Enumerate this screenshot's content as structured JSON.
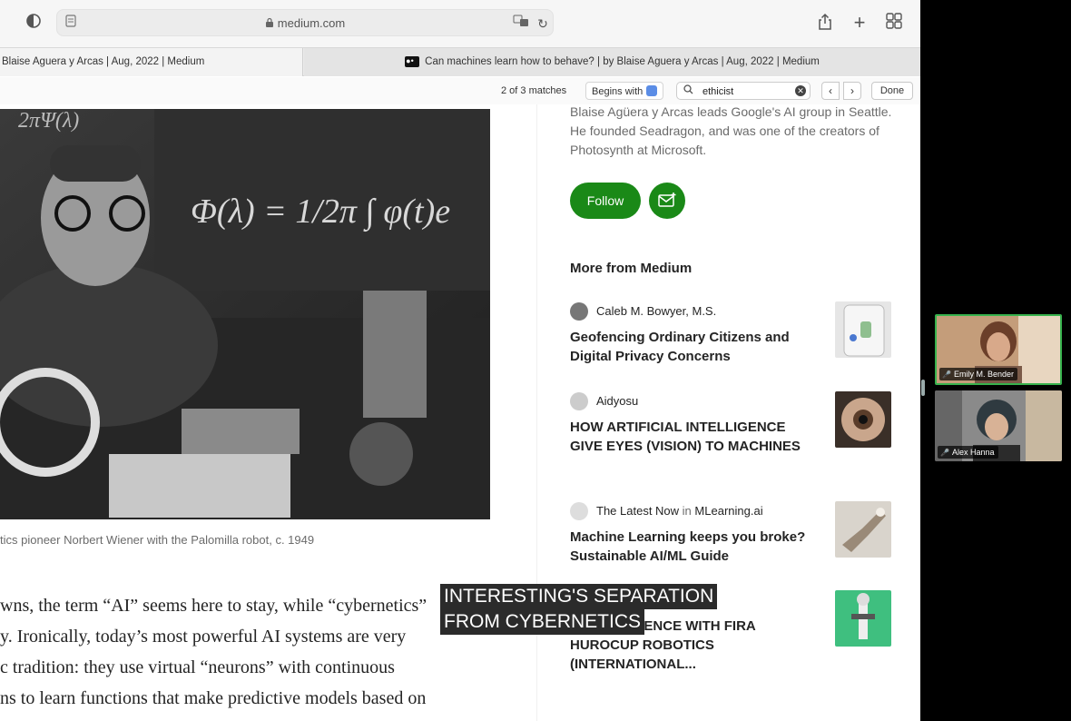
{
  "browser": {
    "address": "medium.com",
    "tabs": [
      {
        "title": "Blaise Aguera y Arcas | Aug, 2022 | Medium"
      },
      {
        "title": "Can machines learn how to behave? | by Blaise Aguera y Arcas | Aug, 2022 | Medium"
      }
    ]
  },
  "find": {
    "count": "2 of 3 matches",
    "begins_with": "Begins with",
    "query": "ethicist",
    "done": "Done"
  },
  "article": {
    "caption": "tics pioneer Norbert Wiener with the Palomilla robot, c. 1949",
    "lines": [
      "wns, the term “AI” seems here to stay, while “cybernetics”",
      "y. Ironically, today’s most powerful AI systems are very",
      "c tradition: they use virtual “neurons” with continuous",
      "ns to learn functions that make predictive models based on"
    ]
  },
  "sidebar": {
    "bio": "Blaise Agüera y Arcas leads Google's AI group in Seattle. He founded Seadragon, and was one of the creators of Photosynth at Microsoft.",
    "follow": "Follow",
    "more_title": "More from Medium",
    "items": [
      {
        "author": "Caleb M. Bowyer, M.S.",
        "title": "Geofencing Ordinary Citizens and Digital Privacy Concerns"
      },
      {
        "author": "Aidyosu",
        "title": "HOW ARTIFICIAL INTELLIGENCE GIVE EYES (VISION) TO MACHINES"
      },
      {
        "author": "The Latest Now",
        "in_label": "in",
        "publication": "MLearning.ai",
        "title": "Machine Learning keeps you broke? Sustainable AI/ML Guide"
      },
      {
        "author": "",
        "title": "MY EXPERIENCE WITH FIRA HUROCUP ROBOTICS (INTERNATIONAL..."
      }
    ]
  },
  "captions": [
    "INTERESTING'S SEPARATION",
    "FROM CYBERNETICS"
  ],
  "participants": [
    {
      "name": "Emily M. Bender"
    },
    {
      "name": "Alex Hanna"
    }
  ]
}
